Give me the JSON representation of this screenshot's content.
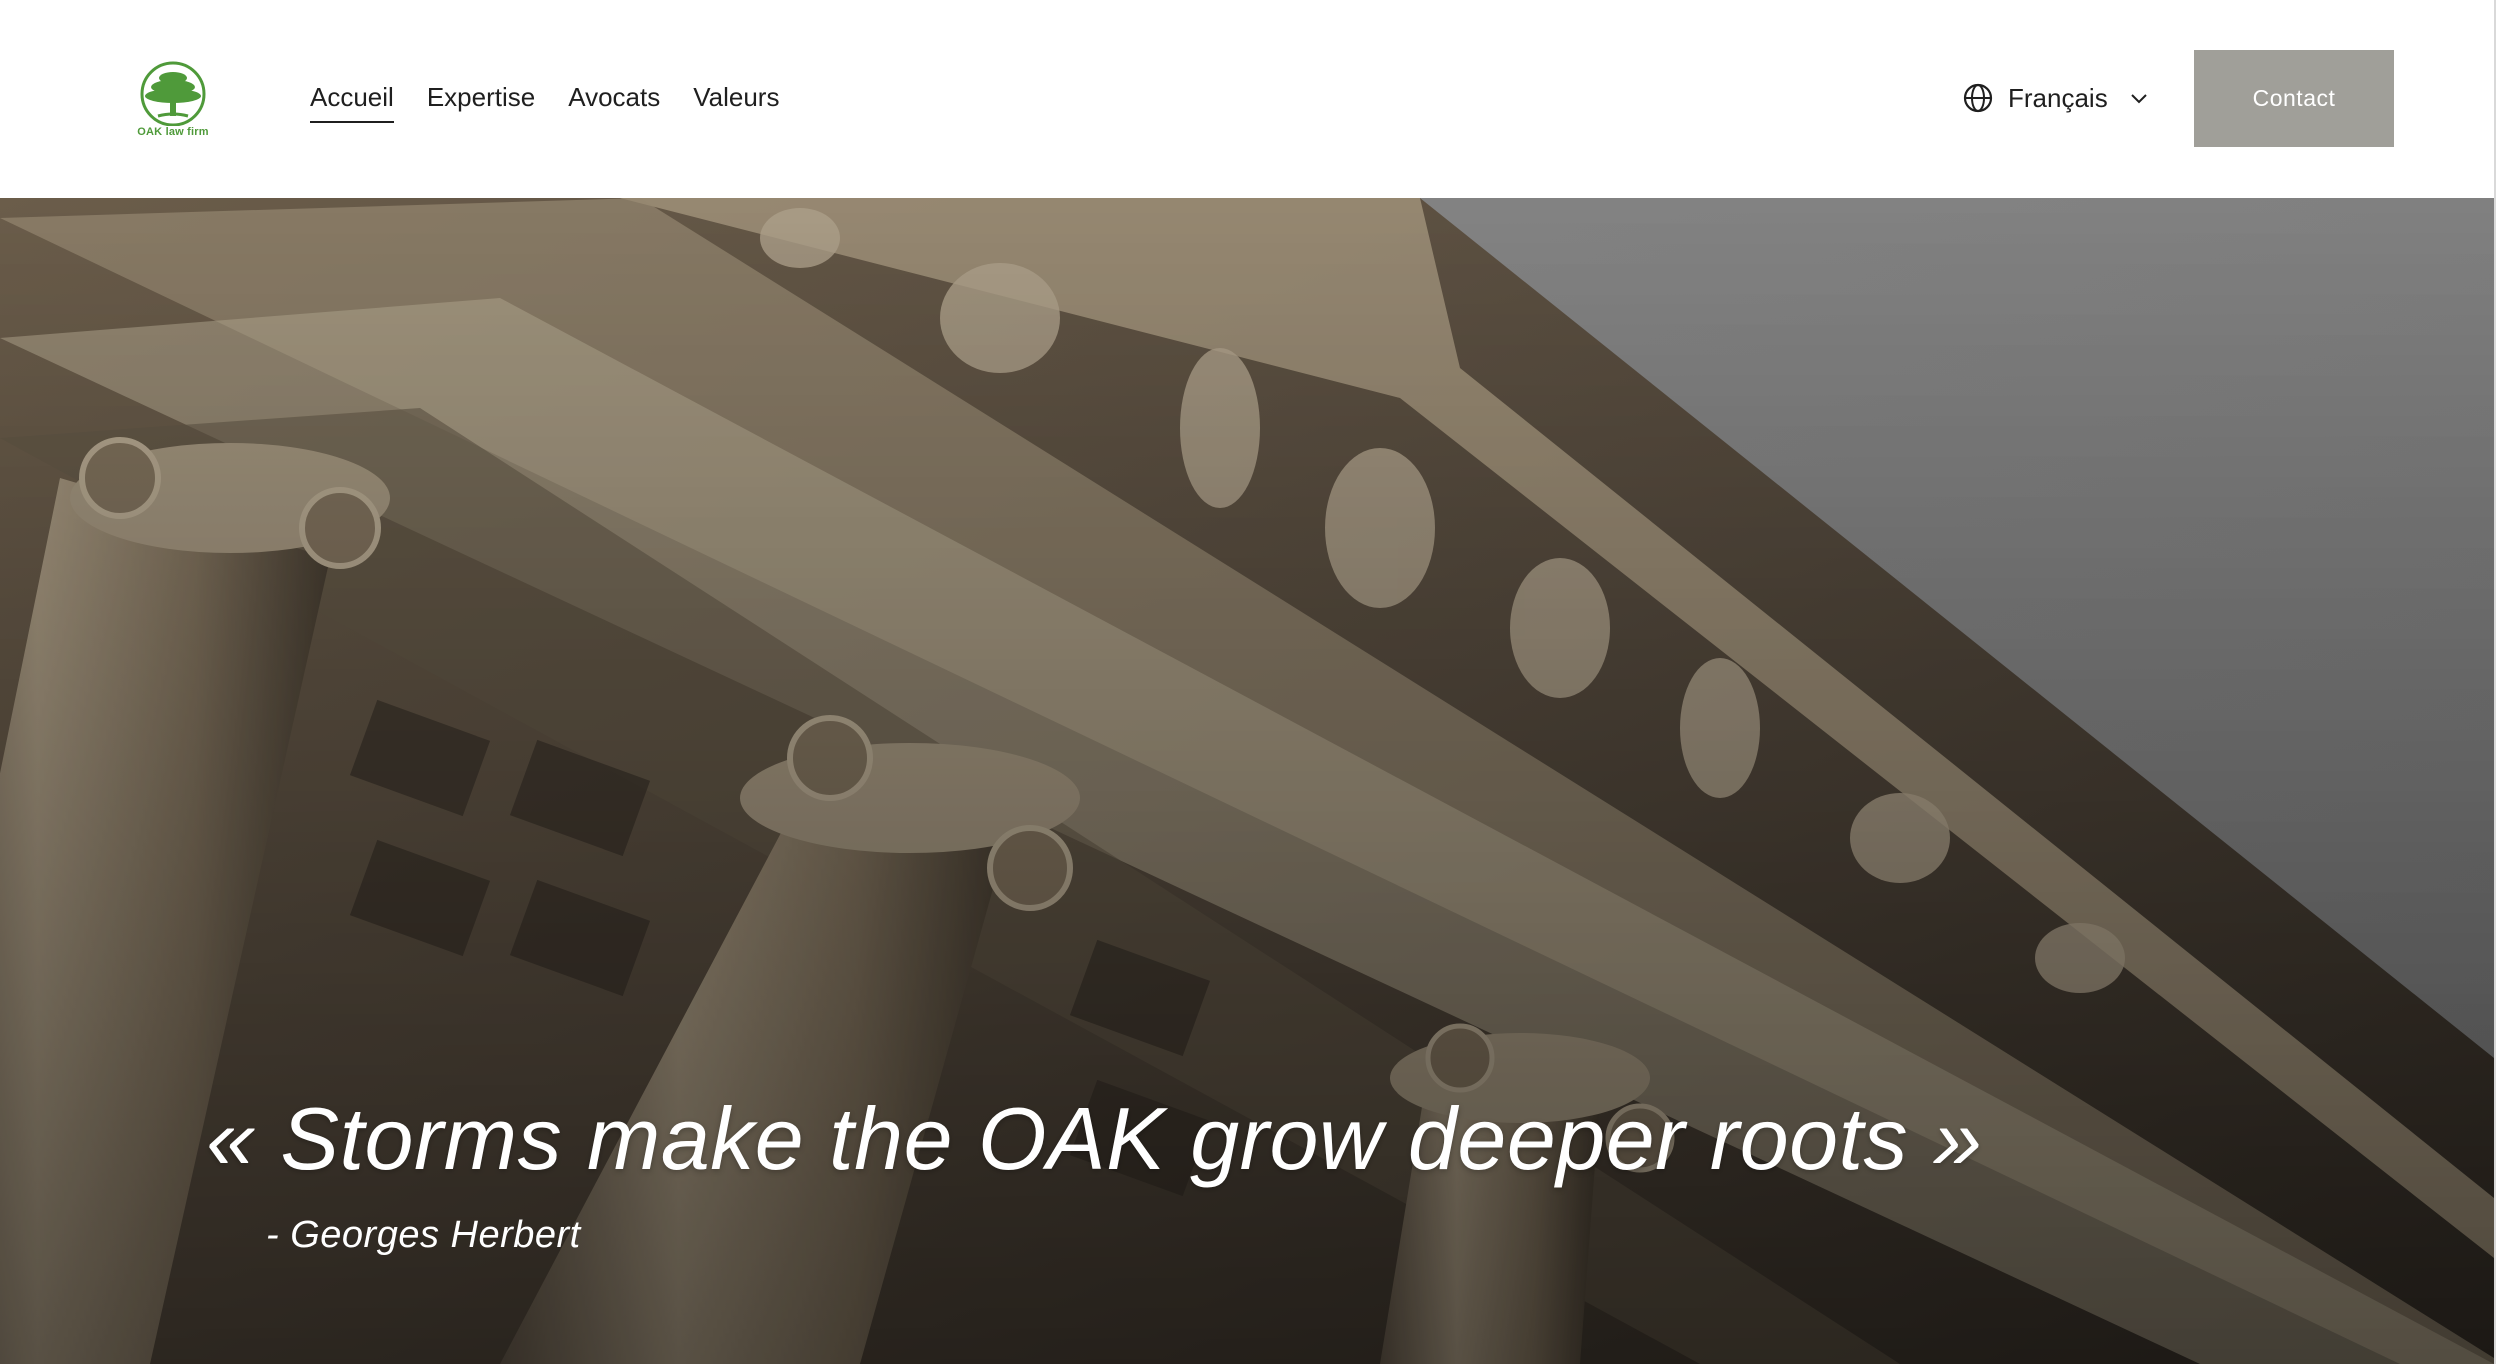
{
  "brand": {
    "logo_text": "OAK law firm",
    "logo_color": "#4f9a3a"
  },
  "nav": {
    "items": [
      {
        "label": "Accueil",
        "active": true
      },
      {
        "label": "Expertise",
        "active": false
      },
      {
        "label": "Avocats",
        "active": false
      },
      {
        "label": "Valeurs",
        "active": false
      }
    ]
  },
  "language": {
    "selected": "Français",
    "icon": "globe-icon",
    "dropdown_icon": "chevron-down-icon"
  },
  "header_cta": {
    "label": "Contact",
    "color": "#a09f99"
  },
  "hero": {
    "quote": "« Storms make the OAK grow deeper roots »",
    "author": "- Georges Herbert",
    "image_subject": "classical-building-columns-icon"
  }
}
